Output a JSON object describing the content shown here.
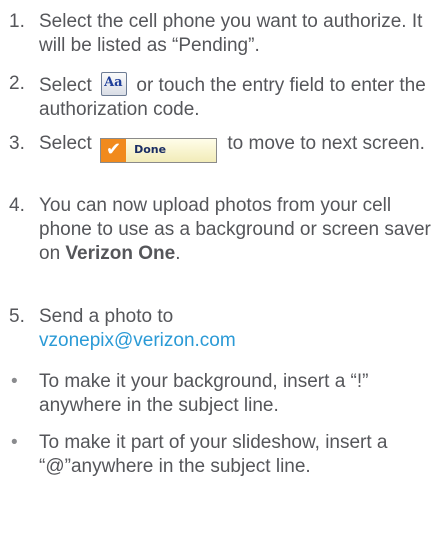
{
  "steps": [
    {
      "num": "1.",
      "text": "Select the cell phone you want to authorize. It will be listed as “Pending”."
    },
    {
      "num": "2.",
      "before": "Select",
      "icon_text": "Aa",
      "after": "or touch the entry field to enter the authorization code."
    },
    {
      "num": "3.",
      "before": "Select",
      "button_label": "Done",
      "after": "to move to next screen."
    },
    {
      "num": "4.",
      "text": "You can now upload photos from your cell phone to use as a background or screen saver on",
      "bold": "Verizon One",
      "end": "."
    },
    {
      "num": "5.",
      "text": "Send a photo to",
      "link": "vzonepix@verizon.com"
    }
  ],
  "bullets": [
    {
      "mark": "•",
      "text": "To make it your background, insert a “!” anywhere in the subject line."
    },
    {
      "mark": "•",
      "text": "To make it part of your slideshow, insert a “@”anywhere in the subject line."
    }
  ],
  "colors": {
    "text": "#55565a",
    "link": "#2a9ad6",
    "check": "#f18a1d"
  },
  "icons": {
    "aa": "text-entry-icon",
    "done": "checkmark-icon"
  }
}
